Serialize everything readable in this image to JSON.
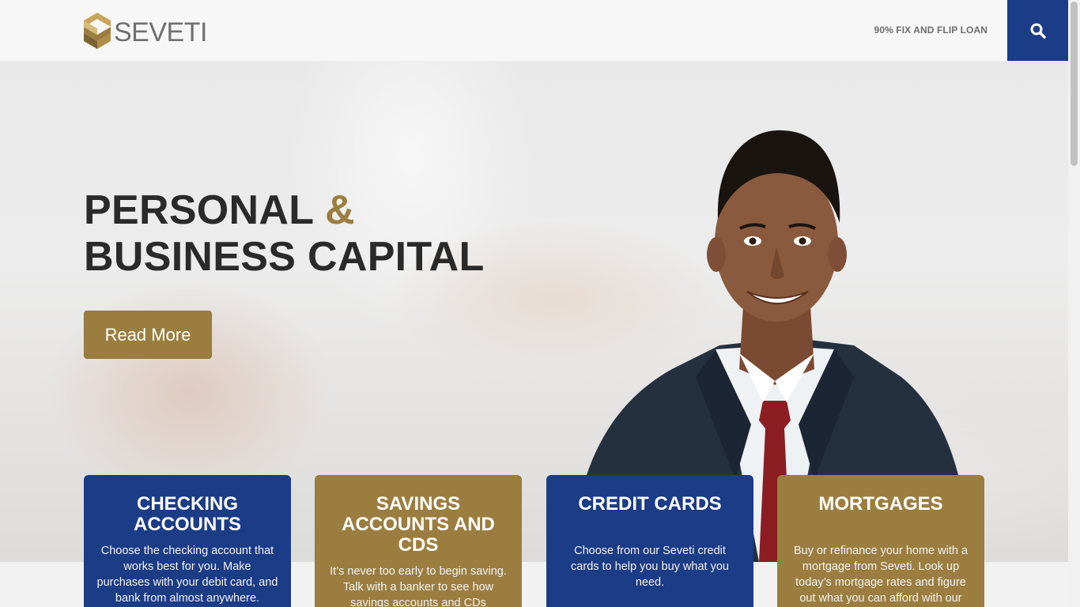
{
  "header": {
    "brand": "SEVETI",
    "nav_link": "90% FIX AND FLIP LOAN",
    "search_icon": "search-icon"
  },
  "hero": {
    "title_line1_a": "PERSONAL",
    "title_amp": "&",
    "title_line2": "BUSINESS CAPITAL",
    "button_label": "Read More"
  },
  "cards": [
    {
      "title": "CHECKING ACCOUNTS",
      "text": "Choose the checking account that works best for you. Make purchases with your debit card, and bank from almost anywhere."
    },
    {
      "title": "SAVINGS ACCOUNTS AND CDS",
      "text": "It’s never too early to begin saving. Talk with a banker to see how savings accounts and CDs"
    },
    {
      "title": "CREDIT CARDS",
      "text": "Choose from our Seveti credit cards to help you buy what you need."
    },
    {
      "title": "MORTGAGES",
      "text": "Buy or refinance your home with a mortgage from Seveti. Look up today’s mortgage rates and figure out what you can afford with our"
    }
  ],
  "colors": {
    "navy": "#1b3c86",
    "gold": "#9b7e3f",
    "text_dark": "#2a2a2a"
  }
}
